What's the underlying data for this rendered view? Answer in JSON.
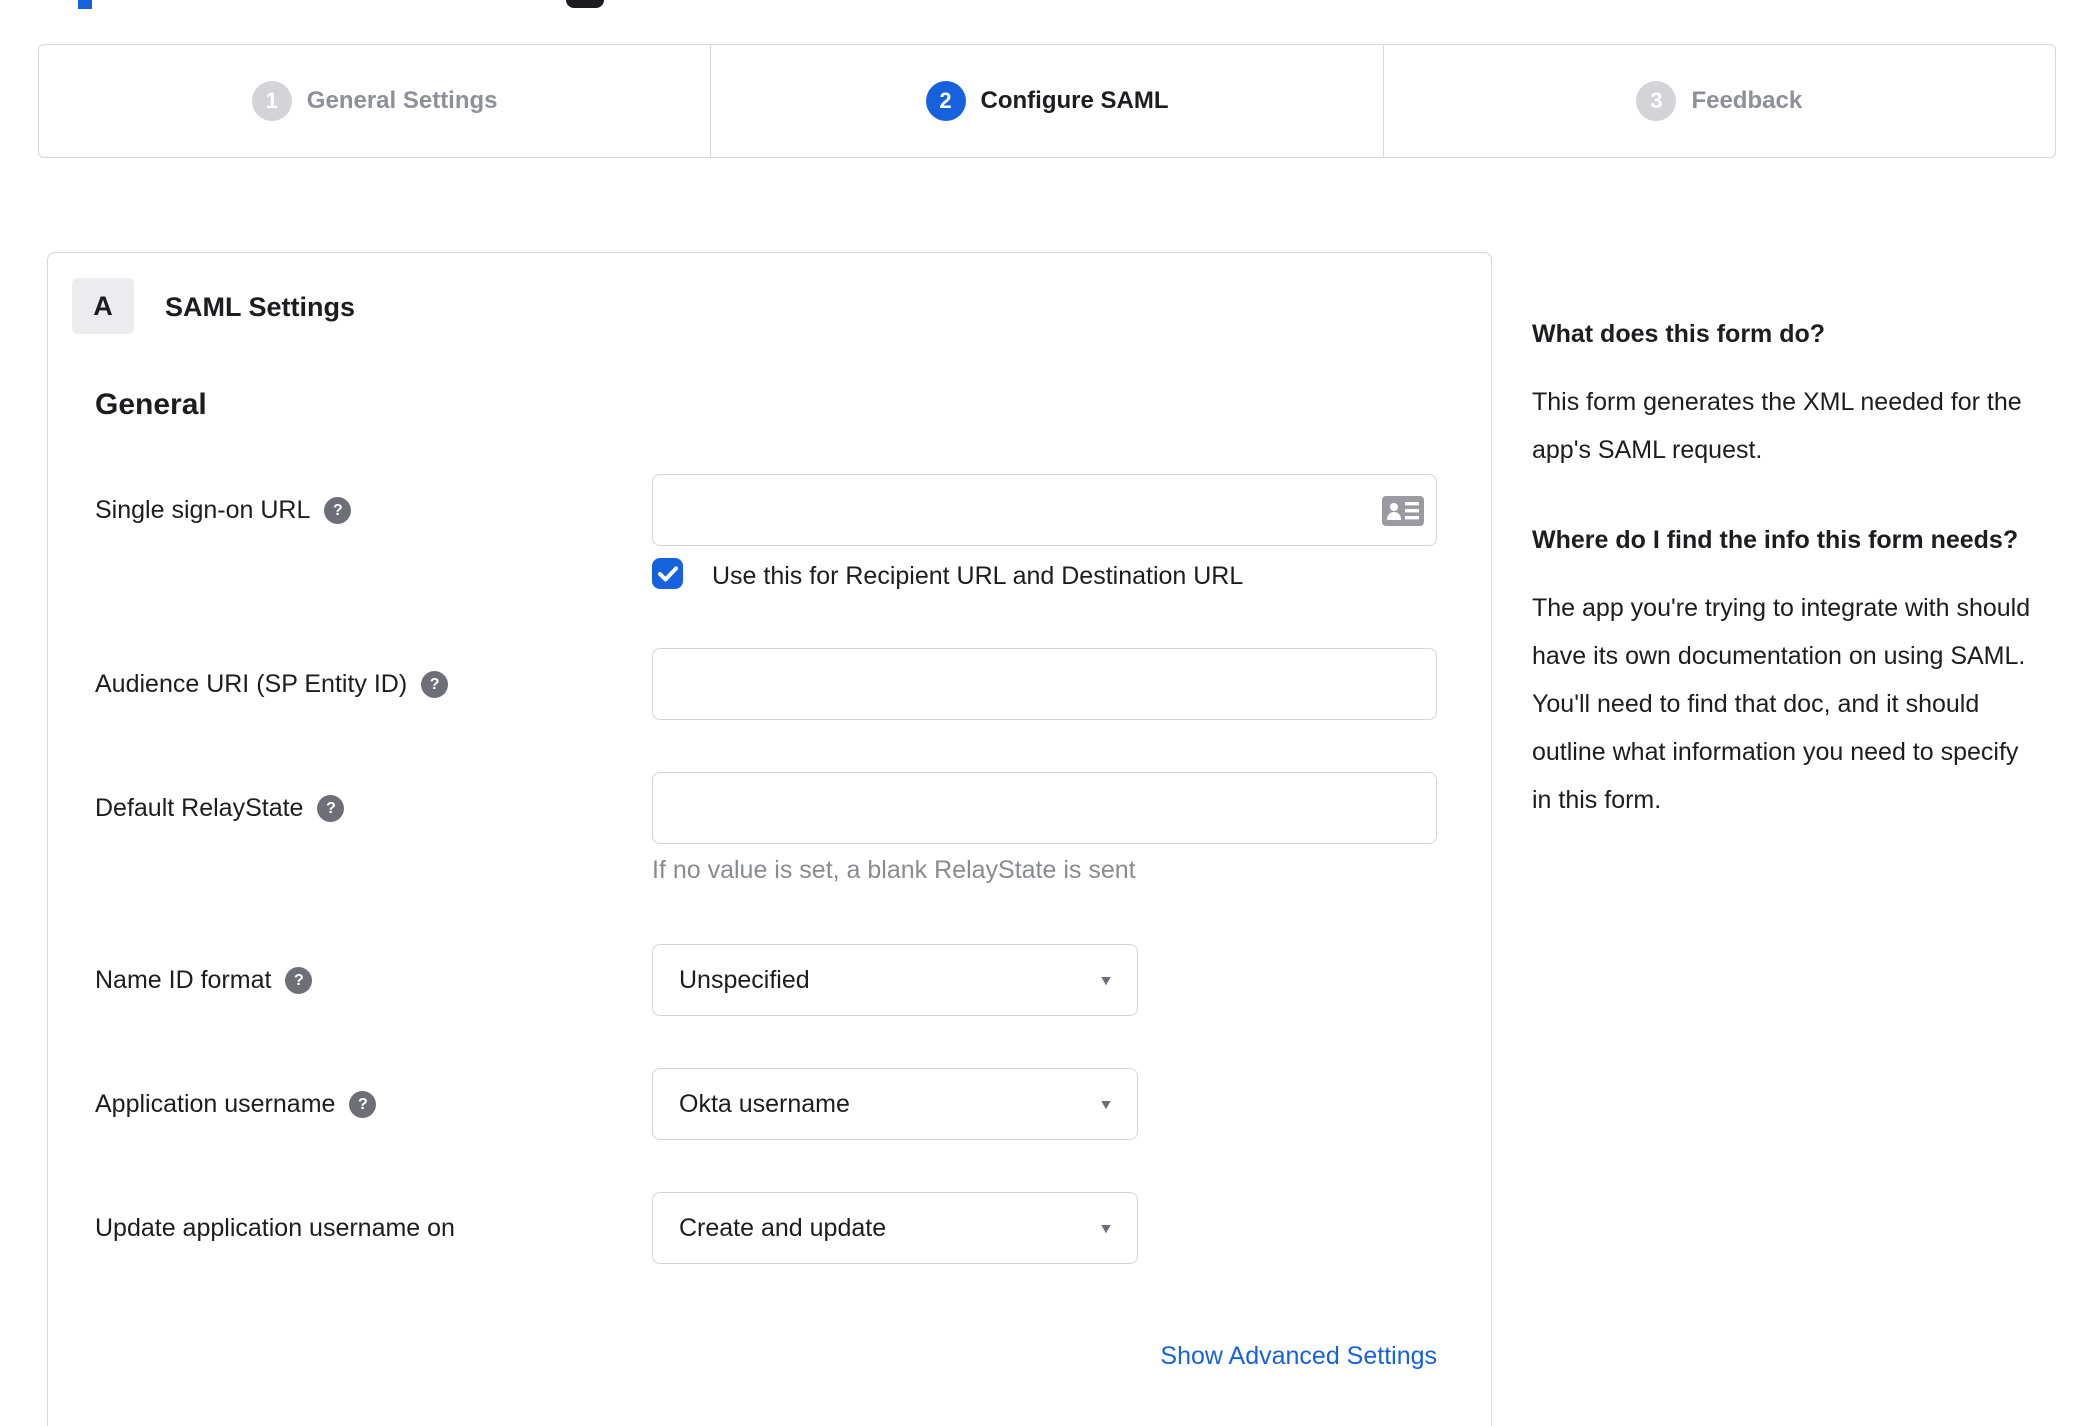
{
  "colors": {
    "accent_blue": "#1662dd",
    "text_dark": "#1d1d21",
    "inactive_gray": "#8f8f99",
    "helper_gray": "#8a8a91",
    "border_gray": "#d8d8dc"
  },
  "stepper": {
    "steps": [
      {
        "number": "1",
        "label": "General Settings",
        "state": "inactive"
      },
      {
        "number": "2",
        "label": "Configure SAML",
        "state": "active"
      },
      {
        "number": "3",
        "label": "Feedback",
        "state": "inactive"
      }
    ]
  },
  "panel": {
    "badge": "A",
    "title": "SAML Settings",
    "section_heading": "General",
    "fields": {
      "sso_url": {
        "label": "Single sign-on URL",
        "value": ""
      },
      "sso_checkbox": {
        "label": "Use this for Recipient URL and Destination URL",
        "checked": true
      },
      "audience_uri": {
        "label": "Audience URI (SP Entity ID)",
        "value": ""
      },
      "relay_state": {
        "label": "Default RelayState",
        "value": "",
        "helper": "If no value is set, a blank RelayState is sent"
      },
      "name_id_format": {
        "label": "Name ID format",
        "value": "Unspecified"
      },
      "app_username": {
        "label": "Application username",
        "value": "Okta username"
      },
      "update_username": {
        "label": "Update application username on",
        "value": "Create and update"
      }
    },
    "advanced_link": "Show Advanced Settings"
  },
  "sidebar": {
    "section1": {
      "heading": "What does this form do?",
      "body": "This form generates the XML needed for the app's SAML request."
    },
    "section2": {
      "heading": "Where do I find the info this form needs?",
      "body": "The app you're trying to integrate with should have its own documentation on using SAML. You'll need to find that doc, and it should outline what information you need to specify in this form."
    }
  }
}
